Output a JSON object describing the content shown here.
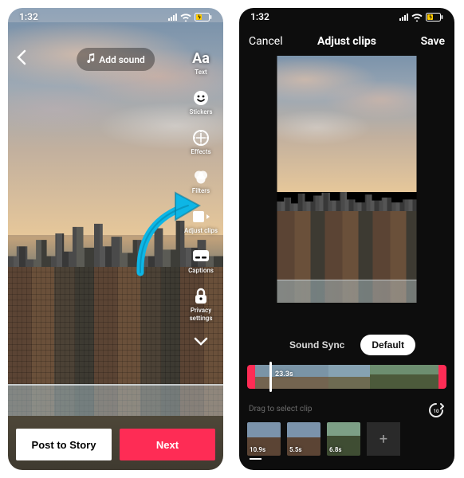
{
  "phone1": {
    "status": {
      "time": "1:32"
    },
    "back": "‹",
    "add_sound": "Add sound",
    "tools": {
      "text": {
        "label": "Text"
      },
      "stickers": {
        "label": "Stickers"
      },
      "effects": {
        "label": "Effects"
      },
      "filters": {
        "label": "Filters"
      },
      "adjust": {
        "label": "Adjust clips"
      },
      "captions": {
        "label": "Captions"
      },
      "privacy": {
        "label1": "Privacy",
        "label2": "settings"
      }
    },
    "post_to_story": "Post to Story",
    "next": "Next"
  },
  "phone2": {
    "status": {
      "time": "1:32"
    },
    "cancel": "Cancel",
    "title": "Adjust clips",
    "save": "Save",
    "modes": {
      "sound_sync": "Sound Sync",
      "default": "Default"
    },
    "timeline": {
      "total_label": "23.3s"
    },
    "drag_hint": "Drag to select clip",
    "clips": [
      {
        "time": "10.9s"
      },
      {
        "time": "5.5s"
      },
      {
        "time": "6.8s"
      }
    ]
  }
}
